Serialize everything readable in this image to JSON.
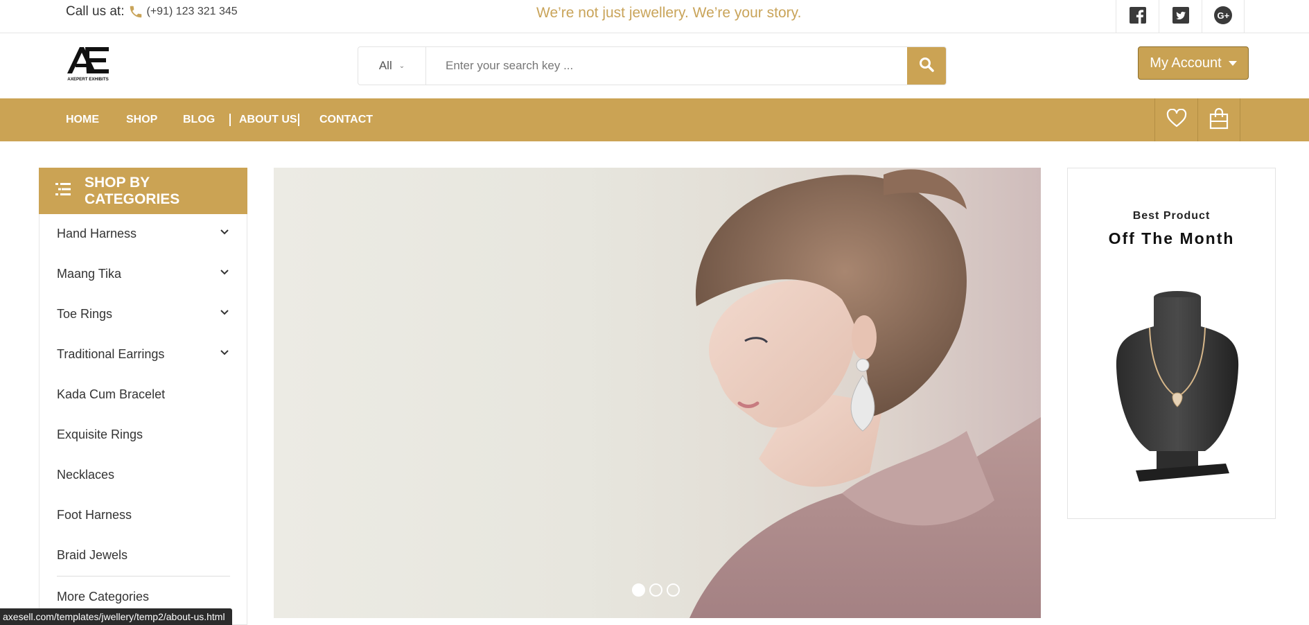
{
  "topbar": {
    "call_label": "Call us at:",
    "phone": "(+91) 123 321 345",
    "tagline": "We’re not just jewellery. We’re your story.",
    "social": [
      "facebook-icon",
      "twitter-icon",
      "google-plus-icon"
    ]
  },
  "header": {
    "logo_text": "AXEPERT EXHIBITS",
    "search": {
      "category": "All",
      "placeholder": "Enter your search key ..."
    },
    "account_label": "My Account"
  },
  "nav": {
    "items": [
      "HOME",
      "SHOP",
      "BLOG",
      "ABOUT US",
      "CONTACT"
    ],
    "icons": [
      "heart-icon",
      "shopping-bag-icon"
    ]
  },
  "sidebar": {
    "title": "SHOP BY CATEGORIES",
    "categories": [
      {
        "label": "Hand Harness",
        "has_sub": true
      },
      {
        "label": "Maang Tika",
        "has_sub": true
      },
      {
        "label": "Toe Rings",
        "has_sub": true
      },
      {
        "label": "Traditional Earrings",
        "has_sub": true
      },
      {
        "label": "Kada Cum Bracelet",
        "has_sub": false
      },
      {
        "label": "Exquisite Rings",
        "has_sub": false
      },
      {
        "label": "Necklaces",
        "has_sub": false
      },
      {
        "label": "Foot Harness",
        "has_sub": false
      },
      {
        "label": "Braid Jewels",
        "has_sub": false
      }
    ],
    "more": "More Categories"
  },
  "hero": {
    "slides": 3,
    "active_slide": 1
  },
  "promo": {
    "subtitle": "Best Product",
    "title": "Off The Month"
  },
  "status_url": "axesell.com/templates/jwellery/temp2/about-us.html",
  "colors": {
    "accent": "#cba354",
    "tagline": "#c9a45a",
    "text": "#333333"
  }
}
